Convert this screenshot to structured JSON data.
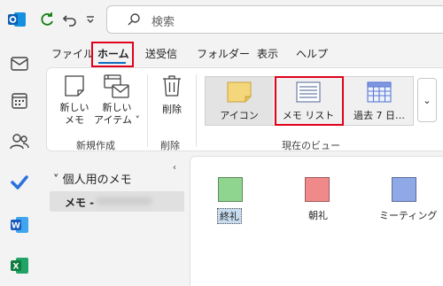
{
  "search": {
    "placeholder": "検索"
  },
  "tabs": [
    "ファイル",
    "ホーム",
    "送受信",
    "フォルダー",
    "表示",
    "ヘルプ"
  ],
  "ribbon": {
    "new_note_label": [
      "新しい",
      "メモ"
    ],
    "new_item_label": [
      "新しい",
      "アイテム ˅"
    ],
    "delete_label": "削除",
    "view_icon_label": "アイコン",
    "view_list_label": "メモ リスト",
    "view_last7_label": "過去 7 日…",
    "dropdown_glyph": "⌄",
    "group_new": "新規作成",
    "group_delete": "削除",
    "group_view": "現在のビュー"
  },
  "nav": {
    "collapse_glyph": "‹",
    "chevron": "˅",
    "folder_group": "個人用のメモ",
    "selected_folder": "メモ -"
  },
  "notes": [
    {
      "title": "終礼",
      "color": "#8fd48f"
    },
    {
      "title": "朝礼",
      "color": "#f08a8a"
    },
    {
      "title": "ミーティング",
      "color": "#8fa8e6"
    }
  ],
  "colors": {
    "accent": "#0f6cbd",
    "highlight_box": "#e0001b"
  }
}
